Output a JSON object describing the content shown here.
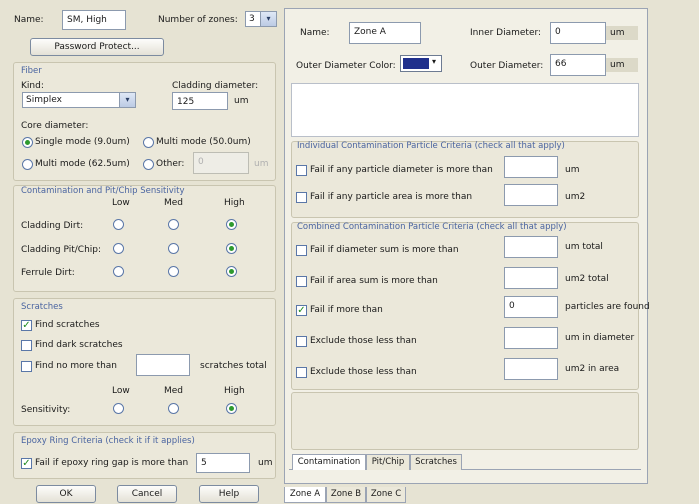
{
  "left": {
    "name_label": "Name:",
    "name_value": "SM, High",
    "zones_label": "Number of zones:",
    "zones_value": "3",
    "password_btn": "Password Protect...",
    "fiber": {
      "title": "Fiber",
      "kind_label": "Kind:",
      "kind_value": "Simplex",
      "cladding_label": "Cladding diameter:",
      "cladding_value": "125",
      "cladding_unit": "um",
      "core_label": "Core diameter:",
      "opt_single": "Single mode (9.0um)",
      "opt_multi50": "Multi mode (50.0um)",
      "opt_multi62": "Multi mode (62.5um)",
      "opt_other": "Other:",
      "other_value": "0",
      "other_unit": "um"
    },
    "sens": {
      "title": "Contamination and Pit/Chip Sensitivity",
      "col_low": "Low",
      "col_med": "Med",
      "col_high": "High",
      "row1": "Cladding Dirt:",
      "row2": "Cladding Pit/Chip:",
      "row3": "Ferrule Dirt:"
    },
    "scratches": {
      "title": "Scratches",
      "find": "Find scratches",
      "find_dark": "Find dark scratches",
      "find_nomore": "Find no more than",
      "total": "scratches total",
      "col_low": "Low",
      "col_med": "Med",
      "col_high": "High",
      "sensitivity": "Sensitivity:"
    },
    "epoxy": {
      "title": "Epoxy Ring Criteria (check it if it applies)",
      "label": "Fail if epoxy ring gap is more than",
      "value": "5",
      "unit": "um"
    },
    "ok": "OK",
    "cancel": "Cancel",
    "help": "Help"
  },
  "right": {
    "name_label": "Name:",
    "name_value": "Zone A",
    "inner_label": "Inner Diameter:",
    "inner_value": "0",
    "inner_unit": "um",
    "outer_color_label": "Outer Diameter Color:",
    "outer_color": "#1f2f8c",
    "outer_label": "Outer Diameter:",
    "outer_value": "66",
    "outer_unit": "um",
    "individual": {
      "title": "Individual Contamination Particle Criteria (check all that apply)",
      "row1": "Fail if any particle diameter is more than",
      "row1_unit": "um",
      "row2": "Fail if any particle area is more than",
      "row2_unit": "um2"
    },
    "combined": {
      "title": "Combined Contamination Particle Criteria (check all that apply)",
      "row1": "Fail if diameter sum is more than",
      "row1_unit": "um total",
      "row2": "Fail if area sum is more than",
      "row2_unit": "um2 total",
      "row3": "Fail if more than",
      "row3_value": "0",
      "row3_unit": "particles are found",
      "row4": "Exclude those less than",
      "row4_unit": "um in diameter",
      "row5": "Exclude those less than",
      "row5_unit": "um2 in area"
    },
    "tabs": [
      "Contamination",
      "Pit/Chip",
      "Scratches"
    ],
    "zone_tabs": [
      "Zone A",
      "Zone B",
      "Zone C"
    ]
  }
}
